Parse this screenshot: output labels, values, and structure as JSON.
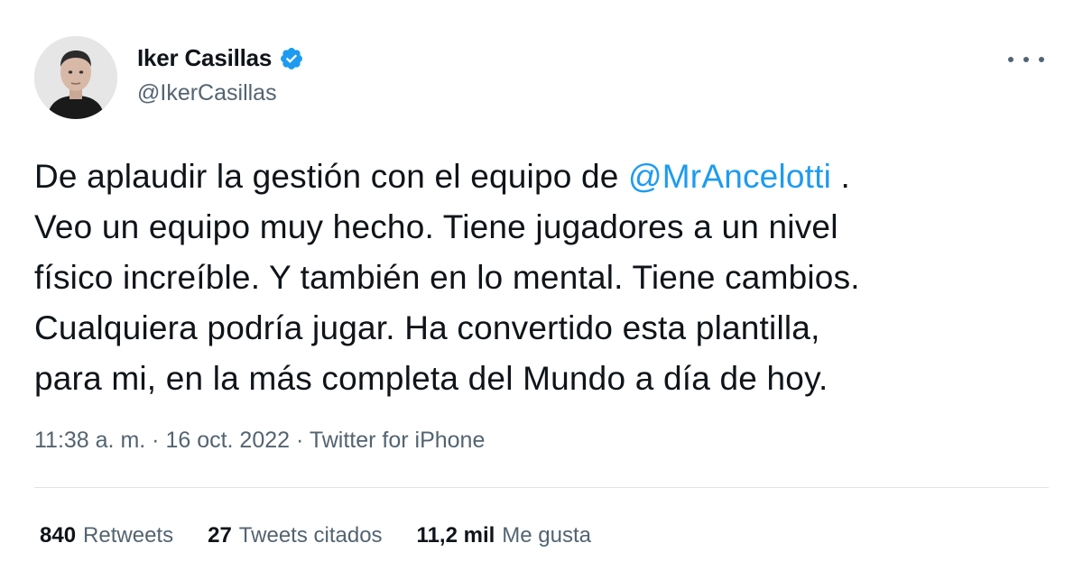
{
  "author": {
    "name": "Iker Casillas",
    "handle": "@IkerCasillas",
    "verified": true
  },
  "tweet": {
    "lines": [
      {
        "before": "De aplaudir la gestión con el equipo de ",
        "mention": "@MrAncelotti",
        "after": " ."
      },
      {
        "text": "Veo un equipo muy hecho. Tiene jugadores a un nivel"
      },
      {
        "text": "físico increíble. Y también en lo mental. Tiene cambios."
      },
      {
        "text": "Cualquiera podría jugar. Ha convertido esta plantilla,"
      },
      {
        "text": "para mi, en la más completa del Mundo a día de hoy."
      }
    ]
  },
  "meta": {
    "time": "11:38 a. m.",
    "date": "16 oct. 2022",
    "source": "Twitter for iPhone",
    "separator": " · "
  },
  "stats": {
    "retweets_count": "840",
    "retweets_label": "Retweets",
    "quotes_count": "27",
    "quotes_label": "Tweets citados",
    "likes_count": "11,2 mil",
    "likes_label": "Me gusta"
  },
  "colors": {
    "accent": "#1d9bf0",
    "secondary_text": "#536471",
    "primary_text": "#0f1419"
  },
  "icons": {
    "verified": "verified-badge-icon",
    "more": "more-options-icon"
  }
}
